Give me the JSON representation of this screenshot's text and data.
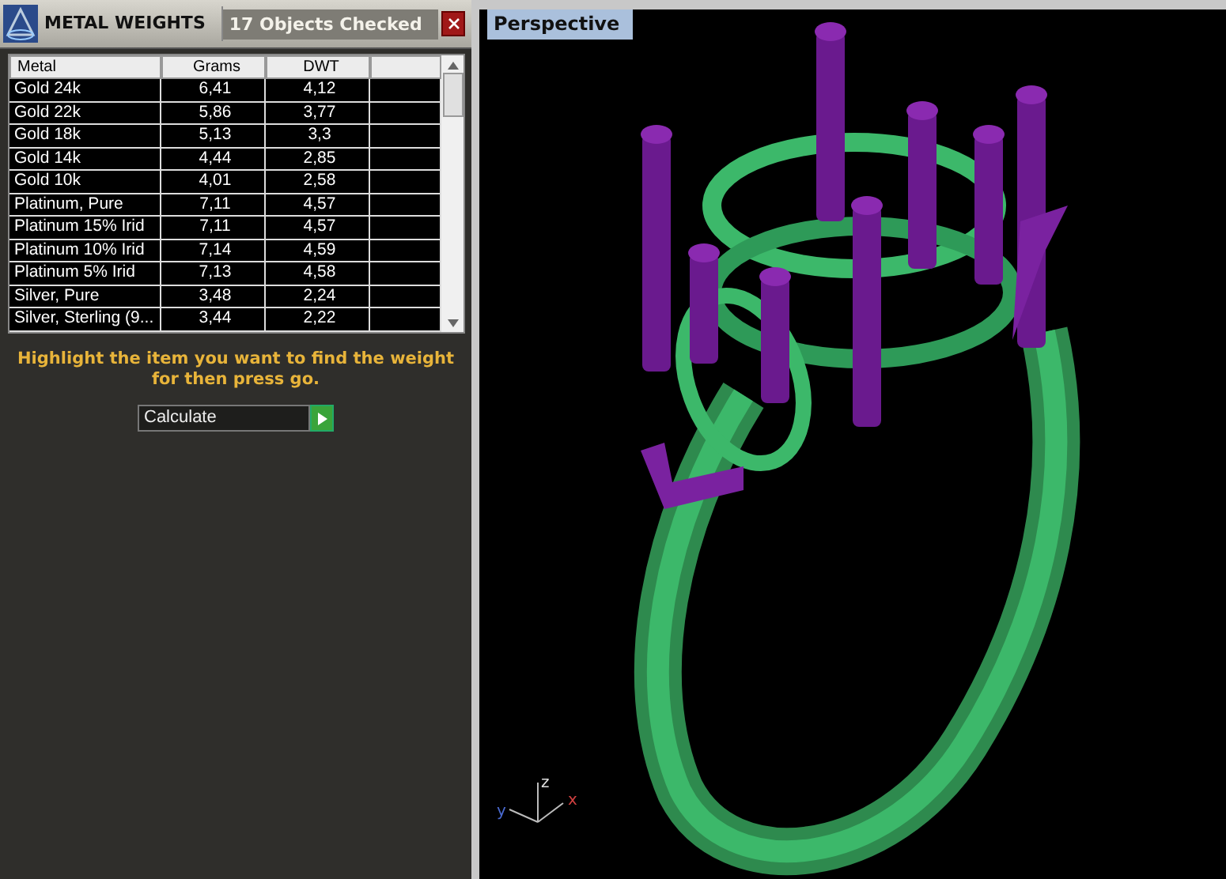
{
  "panel": {
    "title": "METAL WEIGHTS",
    "status": "17 Objects Checked"
  },
  "table": {
    "columns": [
      "Metal",
      "Grams",
      "DWT"
    ],
    "rows": [
      [
        "Gold 24k",
        "6,41",
        "4,12"
      ],
      [
        "Gold 22k",
        "5,86",
        "3,77"
      ],
      [
        "Gold 18k",
        "5,13",
        "3,3"
      ],
      [
        "Gold 14k",
        "4,44",
        "2,85"
      ],
      [
        "Gold 10k",
        "4,01",
        "2,58"
      ],
      [
        "Platinum, Pure",
        "7,11",
        "4,57"
      ],
      [
        "Platinum 15% Irid",
        "7,11",
        "4,57"
      ],
      [
        "Platinum 10% Irid",
        "7,14",
        "4,59"
      ],
      [
        "Platinum 5% Irid",
        "7,13",
        "4,58"
      ],
      [
        "Silver, Pure",
        "3,48",
        "2,24"
      ],
      [
        "Silver, Sterling (9...",
        "3,44",
        "2,22"
      ]
    ]
  },
  "instruction": "Highlight the item you want to find the weight for then press go.",
  "action": {
    "value": "Calculate"
  },
  "viewport": {
    "label": "Perspective",
    "axes": [
      "z",
      "y",
      "x"
    ]
  }
}
